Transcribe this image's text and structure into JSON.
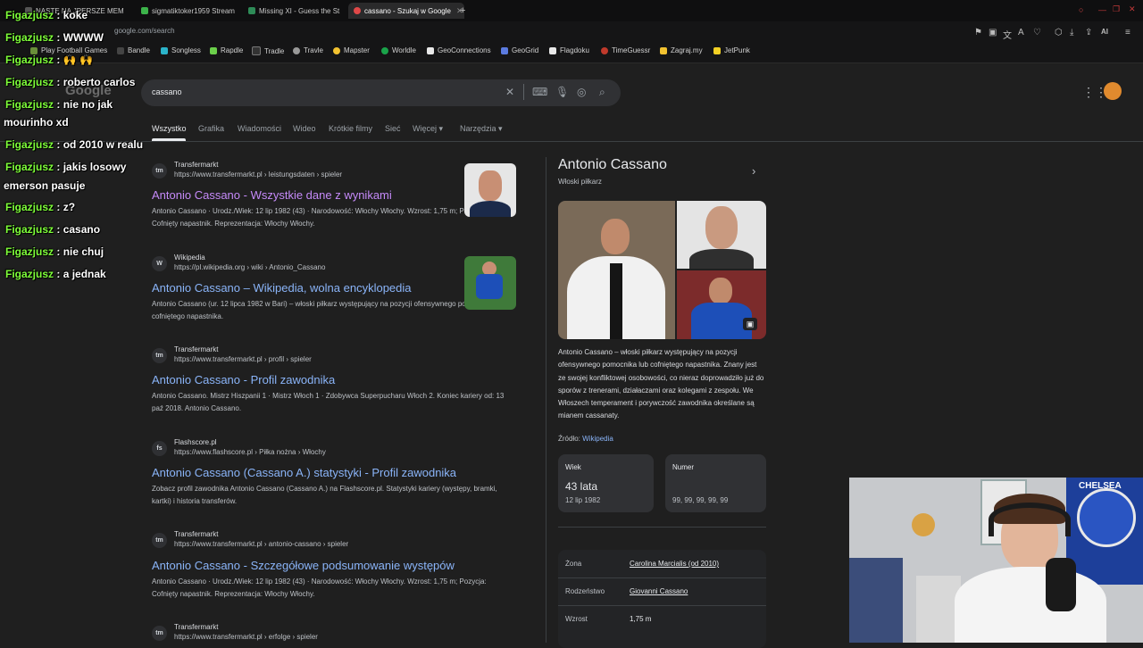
{
  "browser": {
    "tabs": [
      {
        "label": "NASTE NA JPERSZE MEM",
        "color": "#555555",
        "active": false
      },
      {
        "label": "sigmatiktoker1959 Stream",
        "color": "#3cb34a",
        "active": false
      },
      {
        "label": "Missing XI - Guess the St",
        "color": "#2e8b57",
        "active": false
      },
      {
        "label": "cassano - Szukaj w Google",
        "color": "#e04848",
        "active": true
      }
    ],
    "new_tab": "+",
    "url": "google.com/search",
    "bookmarks": [
      {
        "label": "Play Football Games",
        "color": "#6a8f3a"
      },
      {
        "label": "Bandle",
        "color": "#444444"
      },
      {
        "label": "Songless",
        "color": "#2bb3c9"
      },
      {
        "label": "Rapdle",
        "color": "#6bcf4a"
      },
      {
        "label": "Tradle",
        "color": "#333333"
      },
      {
        "label": "Travle",
        "color": "#999999"
      },
      {
        "label": "Mapster",
        "color": "#f2c230"
      },
      {
        "label": "Worldle",
        "color": "#1aa34a"
      },
      {
        "label": "GeoConnections",
        "color": "#e8e8e8"
      },
      {
        "label": "GeoGrid",
        "color": "#5b7be0"
      },
      {
        "label": "Flagdoku",
        "color": "#e8e8e8"
      },
      {
        "label": "TimeGuessr",
        "color": "#c0392b"
      },
      {
        "label": "Zagraj.my",
        "color": "#f2c230"
      },
      {
        "label": "JetPunk",
        "color": "#f2d024"
      }
    ],
    "ai_label": "AI"
  },
  "google": {
    "logo": "Google",
    "query": "cassano",
    "tabs": [
      "Wszystko",
      "Grafika",
      "Wiadomości",
      "Wideo",
      "Krótkie filmy",
      "Sieć",
      "Więcej",
      "Narzędzia"
    ],
    "results": [
      {
        "site": "Transfermarkt",
        "url": "https://www.transfermarkt.pl › leistungsdaten › spieler",
        "title": "Antonio Cassano - Wszystkie dane z wynikami",
        "snippet": "Antonio Cassano · Urodz./Wiek: 12 lip 1982 (43) · Narodowość: Włochy Włochy. Wzrost: 1,75 m; Pozycja: Cofnięty napastnik. Reprezentacja: Włochy Włochy.",
        "favicon": "tm"
      },
      {
        "site": "Wikipedia",
        "url": "https://pl.wikipedia.org › wiki › Antonio_Cassano",
        "title": "Antonio Cassano – Wikipedia, wolna encyklopedia",
        "snippet": "Antonio Cassano (ur. 12 lipca 1982 w Bari) – włoski piłkarz występujący na pozycji ofensywnego pomocnika lub cofniętego napastnika.",
        "favicon": "W"
      },
      {
        "site": "Transfermarkt",
        "url": "https://www.transfermarkt.pl › profil › spieler",
        "title": "Antonio Cassano - Profil zawodnika",
        "snippet": "Antonio Cassano. Mistrz Hiszpanii 1 · Mistrz Włoch 1 · Zdobywca Superpucharu Włoch 2. Koniec kariery od: 13 paź 2018. Antonio Cassano.",
        "favicon": "tm"
      },
      {
        "site": "Flashscore.pl",
        "url": "https://www.flashscore.pl › Piłka nożna › Włochy",
        "title": "Antonio Cassano (Cassano A.) statystyki - Profil zawodnika",
        "snippet": "Zobacz profil zawodnika Antonio Cassano (Cassano A.) na Flashscore.pl. Statystyki kariery (występy, bramki, kartki) i historia transferów.",
        "favicon": "fs"
      },
      {
        "site": "Transfermarkt",
        "url": "https://www.transfermarkt.pl › antonio-cassano › spieler",
        "title": "Antonio Cassano - Szczegółowe podsumowanie występów",
        "snippet": "Antonio Cassano · Urodz./Wiek: 12 lip 1982 (43) · Narodowość: Włochy Włochy. Wzrost: 1,75 m; Pozycja: Cofnięty napastnik. Reprezentacja: Włochy Włochy.",
        "favicon": "tm"
      },
      {
        "site": "Transfermarkt",
        "url": "https://www.transfermarkt.pl › erfolge › spieler",
        "title": "",
        "snippet": "",
        "favicon": "tm"
      }
    ],
    "knowledge_panel": {
      "name": "Antonio Cassano",
      "subtitle": "Włoski piłkarz",
      "description": "Antonio Cassano – włoski piłkarz występujący na pozycji ofensywnego pomocnika lub cofniętego napastnika. Znany jest ze swojej konfliktowej osobowości, co nieraz doprowadziło już do sporów z trenerami, działaczami oraz kolegami z zespołu. We Włoszech temperament i porywczość zawodnika określane są mianem cassanaty.",
      "source_label": "Źródło:",
      "source_link": "Wikipedia",
      "cards": [
        {
          "label": "Wiek",
          "value": "43 lata",
          "sub": "12 lip 1982"
        },
        {
          "label": "Numer",
          "value": "",
          "sub": "99, 99, 99, 99, 99"
        }
      ],
      "facts": [
        {
          "label": "Żona",
          "value": "Carolina Marcialis (od 2010)",
          "link": true
        },
        {
          "label": "Rodzeństwo",
          "value": "Giovanni Cassano",
          "link": true
        },
        {
          "label": "Wzrost",
          "value": "1,75 m",
          "link": false
        }
      ]
    }
  },
  "chat": [
    {
      "user": "Figazjusz",
      "msg": "koke"
    },
    {
      "user": "Figazjusz",
      "msg": "WWWW"
    },
    {
      "user": "Figazjusz",
      "msg": "🙌 🙌"
    },
    {
      "user": "Figazjusz",
      "msg": "roberto carlos"
    },
    {
      "user": "Figazjusz",
      "msg": "nie no jak"
    },
    {
      "user": "",
      "msg": "mourinho xd"
    },
    {
      "user": "Figazjusz",
      "msg": "od 2010 w realu"
    },
    {
      "user": "Figazjusz",
      "msg": "jakis losowy"
    },
    {
      "user": "",
      "msg": "emerson pasuje"
    },
    {
      "user": "Figazjusz",
      "msg": "z?"
    },
    {
      "user": "Figazjusz",
      "msg": "casano"
    },
    {
      "user": "Figazjusz",
      "msg": "nie chuj"
    },
    {
      "user": "Figazjusz",
      "msg": "a jednak"
    }
  ],
  "webcam": {
    "poster_text": "CHELSEA"
  }
}
